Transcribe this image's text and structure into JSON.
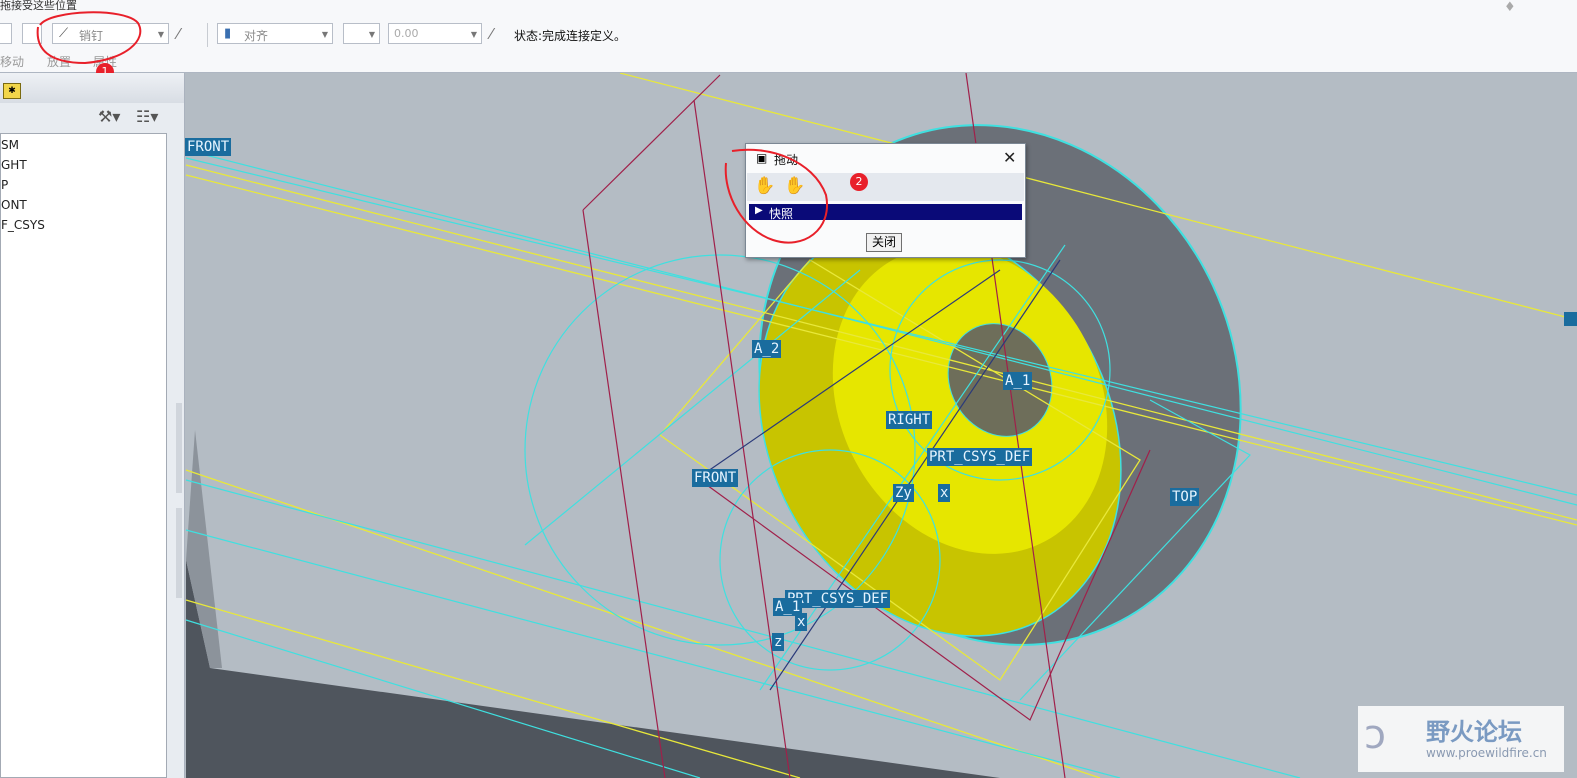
{
  "dashboard": {
    "hint_text": "拖接受这些位置",
    "constraint_type": "销钉",
    "constraint_combo2": "对齐",
    "offset_value": "0.00",
    "status": "状态:完成连接定义。",
    "lower_labels": [
      "移动",
      "放置",
      "属性"
    ]
  },
  "tree": {
    "items": [
      "SM",
      "GHT",
      "P",
      "ONT",
      "F_CSYS"
    ]
  },
  "datum_labels": {
    "front_top": "FRONT",
    "a2": "A_2",
    "a1": "A_1",
    "right": "RIGHT",
    "prt_csys": "PRT_CSYS_DEF",
    "front2": "FRONT",
    "top": "TOP",
    "zy": "Zy",
    "x": "x",
    "prt_csys2": "PRT_CSYS_DEF",
    "a1b": "A_1",
    "x2": "x",
    "z2": "z"
  },
  "drag_dialog": {
    "title": "拖动",
    "snapshot": "快照",
    "close_label": "关闭"
  },
  "annotations": {
    "badge1": "1",
    "badge2": "2"
  },
  "watermark": {
    "title": "野火论坛",
    "url": "www.proewildfire.cn"
  }
}
